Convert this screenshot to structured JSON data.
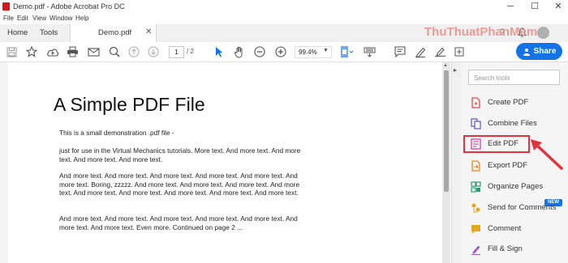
{
  "window": {
    "title": "Demo.pdf - Adobe Acrobat Pro DC",
    "controls": {
      "minimize": "─",
      "maximize": "☐",
      "close": "✕"
    }
  },
  "menu": [
    "File",
    "Edit",
    "View",
    "Window",
    "Help"
  ],
  "tabs": {
    "home": "Home",
    "tools": "Tools",
    "document": "Demo.pdf",
    "close_glyph": "✕"
  },
  "toolbar": {
    "page_current": "1",
    "page_total": "/ 2",
    "zoom": "99.4%",
    "share_label": "Share",
    "icons": [
      "save-icon",
      "star-icon",
      "upload-icon",
      "print-icon",
      "email-icon",
      "zoom-search-icon",
      "prev-page-icon",
      "next-page-icon",
      "select-cursor-icon",
      "hand-icon",
      "zoom-out-icon",
      "zoom-in-icon",
      "fit-page-icon",
      "keyboard-icon",
      "comment-icon",
      "highlight-pen-icon",
      "sign-icon"
    ]
  },
  "document": {
    "title": "A Simple PDF File",
    "paragraphs": [
      "This is a small demonstration .pdf file -",
      "just for use in the Virtual Mechanics tutorials. More text. And more text. And more text. And more text. And more text.",
      "And more text. And more text. And more text. And more text. And more text. And more text. Boring, zzzzz. And more text. And more text. And more text. And more text. And more text. And more text. And more text. And more text. And more text.",
      "And more text. And more text. And more text. And more text. And more text. And more text. And more text. Even more. Continued on page 2 ..."
    ]
  },
  "tools_pane": {
    "search_placeholder": "Search tools",
    "new_badge": "NEW",
    "items": [
      {
        "label": "Create PDF",
        "icon": "create-pdf-icon",
        "color": "#e34850"
      },
      {
        "label": "Combine Files",
        "icon": "combine-files-icon",
        "color": "#6b5bd2"
      },
      {
        "label": "Edit PDF",
        "icon": "edit-pdf-icon",
        "color": "#d83790"
      },
      {
        "label": "Export PDF",
        "icon": "export-pdf-icon",
        "color": "#e68619"
      },
      {
        "label": "Organize Pages",
        "icon": "organize-pages-icon",
        "color": "#2d9d78"
      },
      {
        "label": "Send for Comments",
        "icon": "send-comments-icon",
        "color": "#e6a817"
      },
      {
        "label": "Comment",
        "icon": "comment-tool-icon",
        "color": "#e6a817"
      },
      {
        "label": "Fill & Sign",
        "icon": "fill-sign-icon",
        "color": "#a05ac8"
      }
    ]
  },
  "watermark": "ThuThuatPhanMem",
  "colors": {
    "accent": "#1473e6",
    "annotation_red": "#e2323d"
  }
}
